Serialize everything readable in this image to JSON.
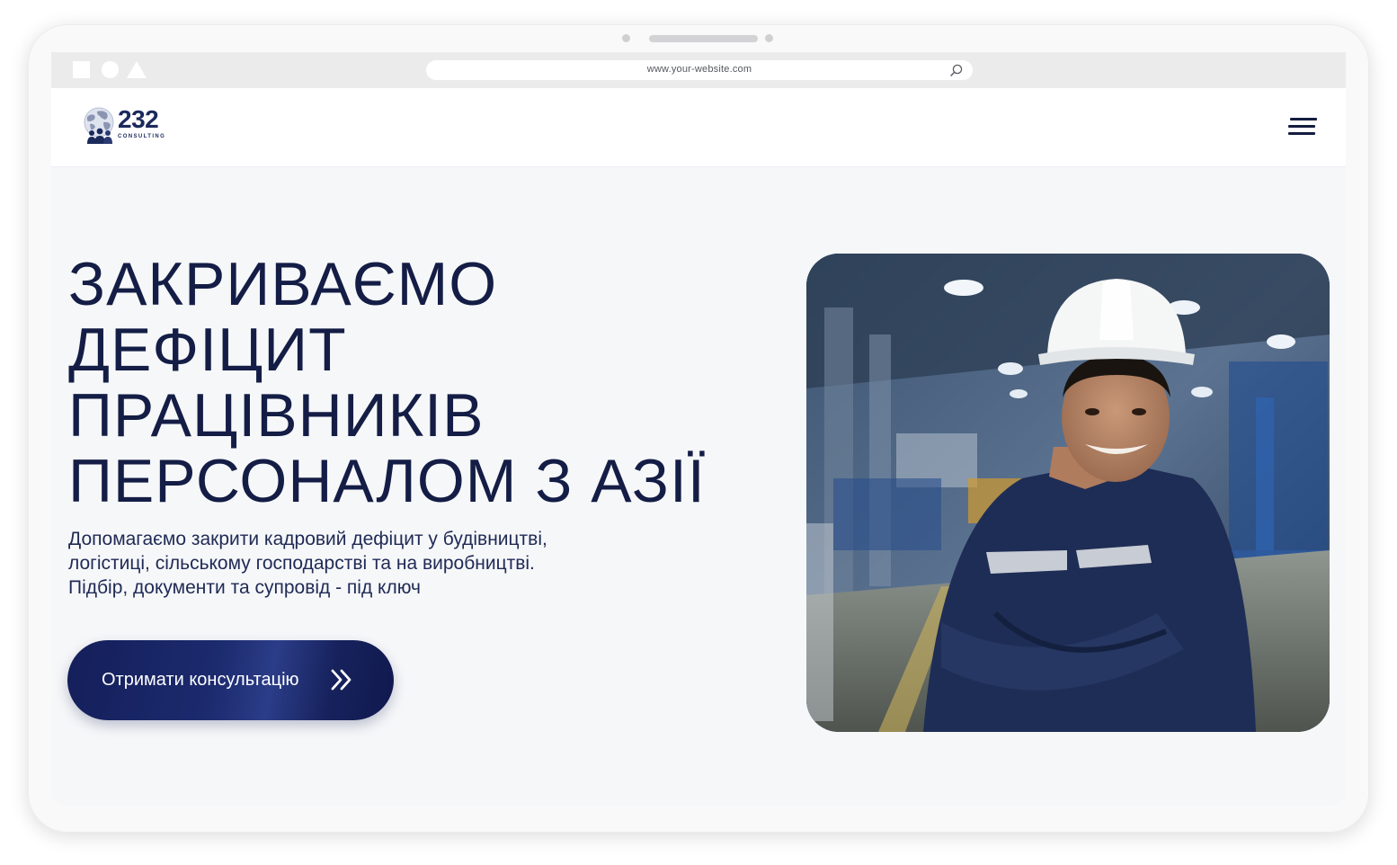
{
  "browser": {
    "url": "www.your-website.com",
    "icons": [
      "square-icon",
      "circle-icon",
      "triangle-icon",
      "search-icon"
    ]
  },
  "brand": {
    "name": "232",
    "tagline": "CONSULTING",
    "colors": {
      "primary": "#1b2a5c",
      "text": "#141d45",
      "background": "#f6f7f9"
    }
  },
  "nav": {
    "menu_icon": "hamburger-menu-icon"
  },
  "hero": {
    "title_lines": [
      "ЗАКРИВАЄМО",
      "ДЕФІЦИТ",
      "ПРАЦІВНИКІВ",
      "ПЕРСОНАЛОМ З АЗІЇ"
    ],
    "subtitle_lines": [
      "Допомагаємо закрити кадровий дефіцит у будівництві,",
      "логістиці, сільському господарстві та на виробництві.",
      "Підбір, документи та супровід - під ключ"
    ],
    "cta_label": "Отримати консультацію",
    "cta_icon": "double-chevron-right-icon",
    "image": "factory-worker-photo"
  }
}
